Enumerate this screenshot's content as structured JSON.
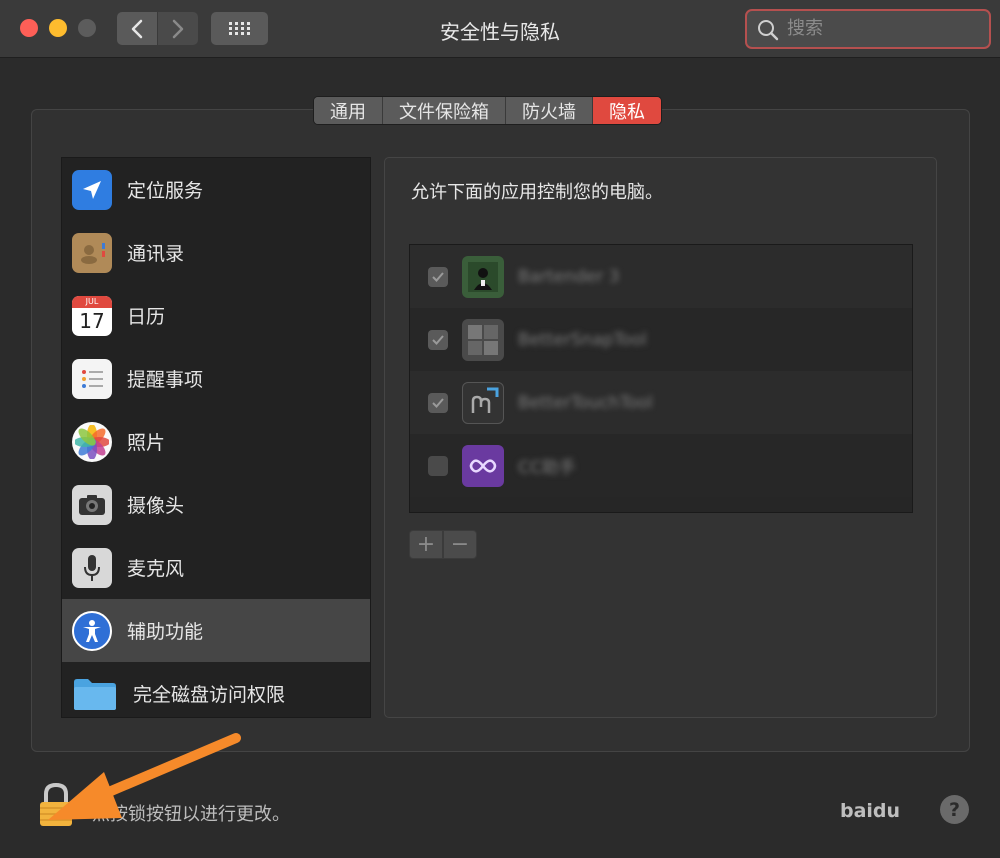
{
  "window": {
    "title": "安全性与隐私"
  },
  "search": {
    "placeholder": "搜索"
  },
  "tabs": [
    {
      "label": "通用",
      "active": false
    },
    {
      "label": "文件保险箱",
      "active": false
    },
    {
      "label": "防火墙",
      "active": false
    },
    {
      "label": "隐私",
      "active": true
    }
  ],
  "sidebar": {
    "items": [
      {
        "label": "定位服务",
        "icon": "location-arrow-icon"
      },
      {
        "label": "通讯录",
        "icon": "contacts-book-icon"
      },
      {
        "label": "日历",
        "icon": "calendar-icon",
        "calendar_month": "JUL",
        "calendar_day": "17"
      },
      {
        "label": "提醒事项",
        "icon": "reminders-icon"
      },
      {
        "label": "照片",
        "icon": "photos-icon"
      },
      {
        "label": "摄像头",
        "icon": "camera-icon"
      },
      {
        "label": "麦克风",
        "icon": "microphone-icon"
      },
      {
        "label": "辅助功能",
        "icon": "accessibility-icon",
        "selected": true
      },
      {
        "label": "完全磁盘访问权限",
        "icon": "folder-icon"
      }
    ]
  },
  "panel": {
    "description": "允许下面的应用控制您的电脑。",
    "apps": [
      {
        "name": "Bartender 3",
        "checked": true,
        "icon": "bartender-app-icon"
      },
      {
        "name": "BetterSnapTool",
        "checked": true,
        "icon": "snap-grid-app-icon"
      },
      {
        "name": "BetterTouchTool",
        "checked": true,
        "icon": "touch-app-icon"
      },
      {
        "name": "CC助手",
        "checked": false,
        "icon": "infinity-app-icon"
      }
    ],
    "add_label": "+",
    "remove_label": "−"
  },
  "footer": {
    "lock_hint": "点按锁按钮以进行更改。",
    "help_label": "?",
    "watermark": "baidu"
  },
  "colors": {
    "accent_red": "#e0493f",
    "annotation_orange": "#f68a2a",
    "selected_row": "#464646"
  }
}
